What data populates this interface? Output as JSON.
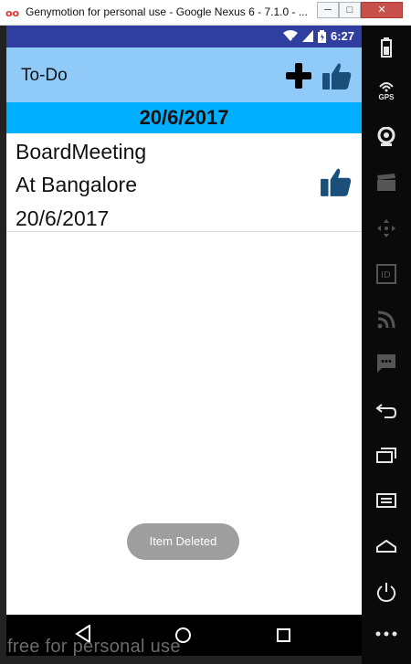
{
  "window": {
    "title": "Genymotion for personal use - Google Nexus 6 - 7.1.0 - ...",
    "logo": "oo",
    "minimize": "─",
    "maximize": "□",
    "close": "✕"
  },
  "status_bar": {
    "time": "6:27",
    "icons": [
      "wifi-icon",
      "signal-icon",
      "battery-icon"
    ]
  },
  "app_bar": {
    "title": "To-Do",
    "actions": [
      "add-icon",
      "thumbs-up-icon"
    ]
  },
  "date_header": "20/6/2017",
  "tasks": [
    {
      "title": "BoardMeeting",
      "location": "At Bangalore",
      "date": "20/6/2017",
      "icon": "thumbs-up-icon"
    }
  ],
  "toast": "Item Deleted",
  "nav_bar": [
    "back-icon",
    "home-icon",
    "recents-icon"
  ],
  "watermark": "free for personal use",
  "sidebar": {
    "gps_label": "GPS",
    "items": [
      "battery-icon",
      "gps-icon",
      "webcam-icon",
      "capture-icon",
      "dpad-icon",
      "id-icon",
      "rss-icon",
      "sms-icon",
      "back-icon",
      "recents-icon",
      "menu-icon",
      "home-icon",
      "power-icon",
      "more-icon"
    ]
  },
  "colors": {
    "status_bar": "#303f9f",
    "app_bar": "#90caf9",
    "date_header": "#00b0ff",
    "thumb": "#1a4f7a",
    "toast": "#9e9e9e"
  }
}
